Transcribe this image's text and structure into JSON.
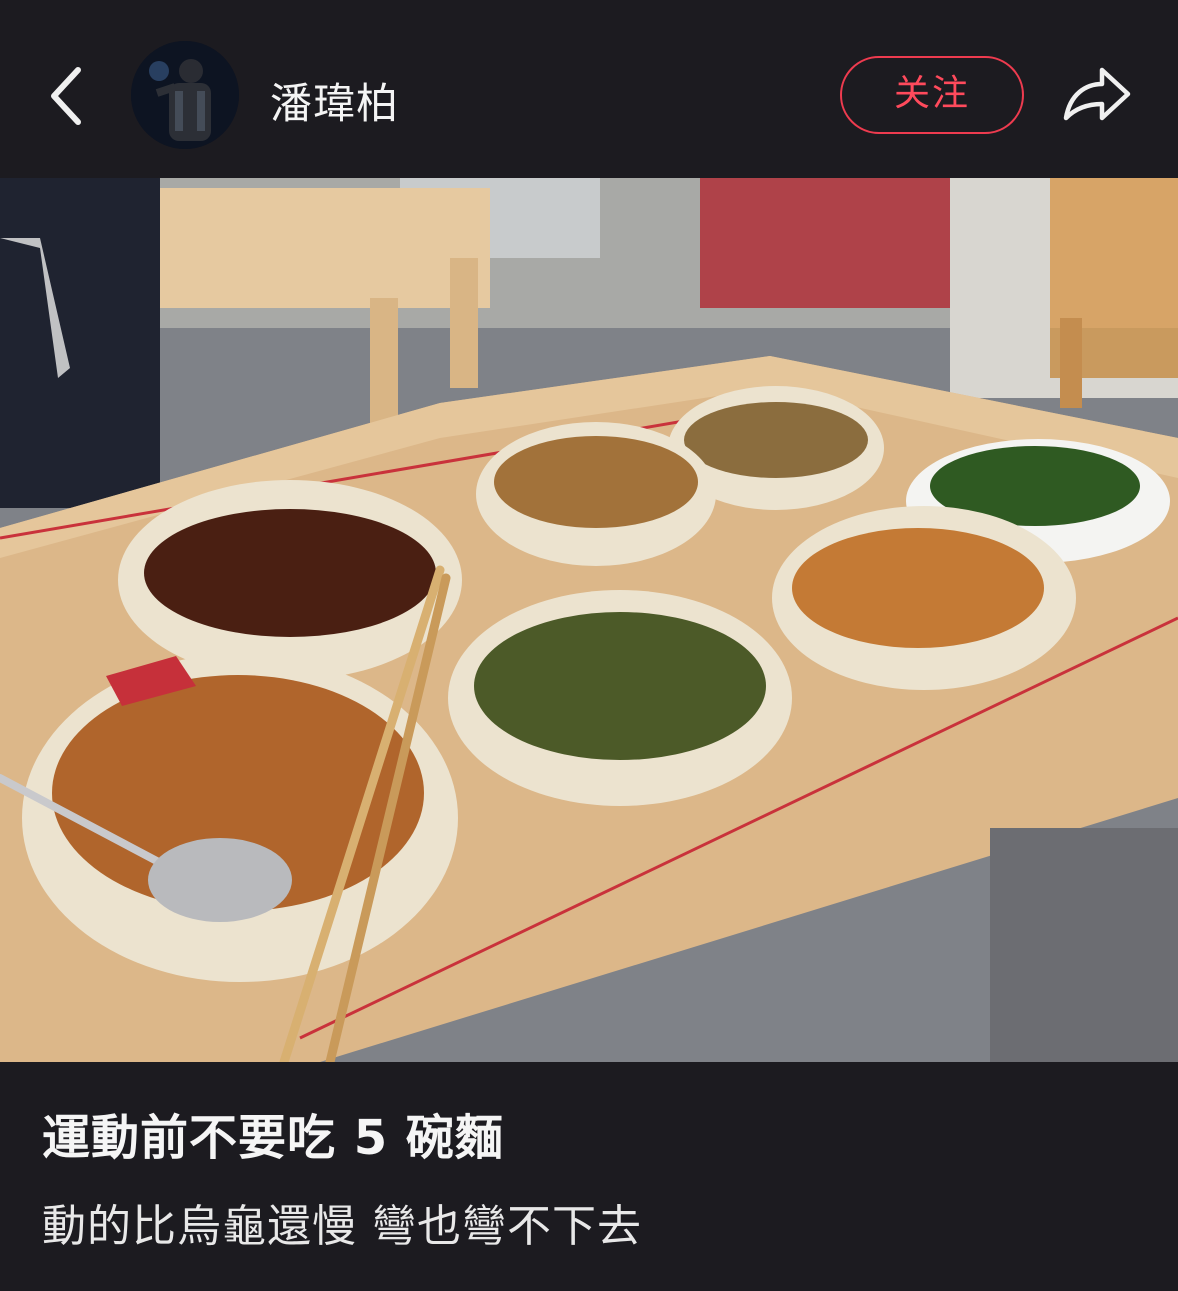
{
  "header": {
    "back_icon": "chevron-left-icon",
    "avatar_icon": "user-avatar",
    "username": "潘瑋柏",
    "follow_label": "关注",
    "share_icon": "share-arrow-icon",
    "accent_color": "#ee3b4f"
  },
  "post": {
    "image_subject": "photo",
    "title": "運動前不要吃 5 碗麵",
    "body": "動的比烏龜還慢 彎也彎不下去"
  }
}
